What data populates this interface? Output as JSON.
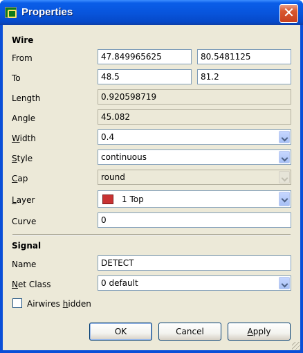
{
  "window": {
    "title": "Properties",
    "close_glyph": "✕"
  },
  "wire": {
    "section_label": "Wire",
    "from_label": "From",
    "from_x": "47.849965625",
    "from_y": "80.5481125",
    "to_label": "To",
    "to_x": "48.5",
    "to_y": "81.2",
    "length_label": "Length",
    "length_value": "0.920598719",
    "angle_label": "Angle",
    "angle_value": "45.082",
    "width_label_pre": "",
    "width_label_mn": "W",
    "width_label_post": "idth",
    "width_value": "0.4",
    "style_label_mn": "S",
    "style_label_post": "tyle",
    "style_value": "continuous",
    "cap_label_mn": "C",
    "cap_label_post": "ap",
    "cap_value": "round",
    "layer_label_mn": "L",
    "layer_label_post": "ayer",
    "layer_value": "1 Top",
    "layer_color": "#c83232",
    "curve_label": "Curve",
    "curve_value": "0"
  },
  "signal": {
    "section_label": "Signal",
    "name_label": "Name",
    "name_value": "DETECT",
    "netclass_label_mn": "N",
    "netclass_label_post": "et Class",
    "netclass_value": "0 default",
    "airwires_label_pre": "Airwires ",
    "airwires_label_mn": "h",
    "airwires_label_post": "idden",
    "airwires_checked": false
  },
  "buttons": {
    "ok": "OK",
    "cancel": "Cancel",
    "apply_mn": "A",
    "apply_post": "pply"
  },
  "colors": {
    "titlebar": "#0855dd",
    "client_bg": "#ece9d8",
    "close_button": "#d9582f"
  }
}
